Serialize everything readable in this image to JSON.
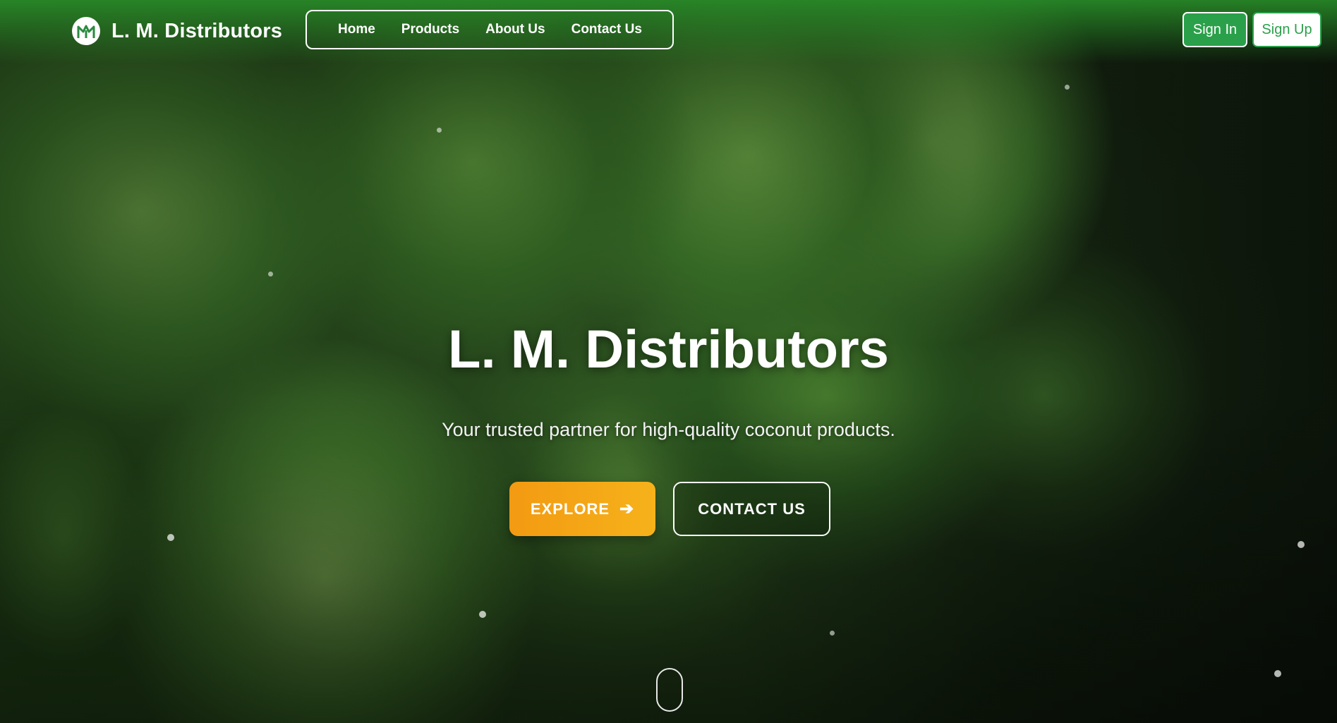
{
  "brand": {
    "name": "L. M. Distributors",
    "logo_icon": "lm-logo-icon"
  },
  "nav": {
    "items": [
      {
        "label": "Home"
      },
      {
        "label": "Products"
      },
      {
        "label": "About Us"
      },
      {
        "label": "Contact Us"
      }
    ]
  },
  "auth": {
    "sign_in": "Sign In",
    "sign_up": "Sign Up",
    "accent": "#2aa04a"
  },
  "hero": {
    "title": "L. M. Distributors",
    "subtitle": "Your trusted partner for high-quality coconut products.",
    "explore_label": "EXPLORE",
    "explore_icon": "arrow-right-icon",
    "contact_label": "CONTACT US",
    "explore_color": "#f5a816"
  },
  "scroll_indicator_icon": "mouse-scroll-icon"
}
